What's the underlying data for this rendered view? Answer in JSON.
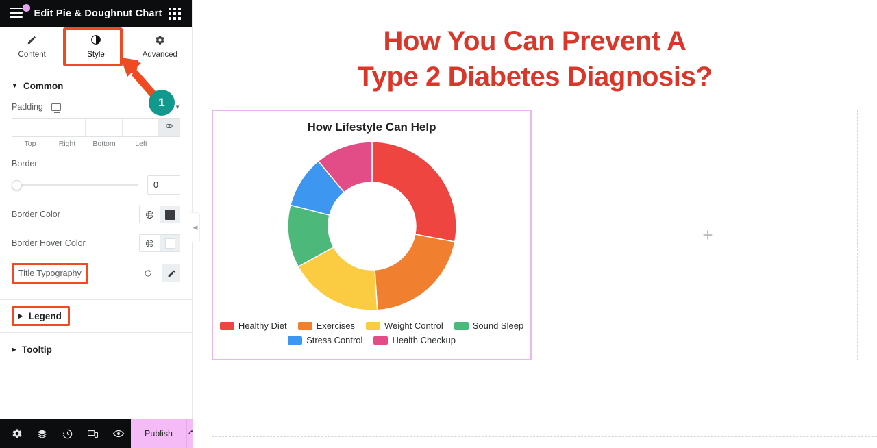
{
  "panel": {
    "title": "Edit Pie & Doughnut Chart",
    "menu_icon": "hamburger-icon",
    "grid_icon": "app-grid-icon",
    "tabs": [
      {
        "label": "Content",
        "icon": "pencil-icon",
        "active": false
      },
      {
        "label": "Style",
        "icon": "contrast-icon",
        "active": true
      },
      {
        "label": "Advanced",
        "icon": "gear-icon",
        "active": false
      }
    ],
    "sections": [
      {
        "label": "Common",
        "expanded": true
      },
      {
        "label": "Legend",
        "expanded": false
      },
      {
        "label": "Tooltip",
        "expanded": false
      }
    ],
    "common": {
      "padding": {
        "label": "Padding",
        "device_icon": "desktop-icon",
        "unit": "px",
        "unit_caret": "chevron-down-icon",
        "link_icon": "link-icon",
        "values": {
          "top": "",
          "right": "",
          "bottom": "",
          "left": ""
        },
        "placeholders": {
          "top": "",
          "right": "",
          "bottom": "",
          "left": ""
        },
        "captions": [
          "Top",
          "Right",
          "Bottom",
          "Left"
        ]
      },
      "border": {
        "label": "Border",
        "value": "0",
        "slider_percent": 0
      },
      "border_color": {
        "label": "Border Color",
        "globe_icon": "globe-icon",
        "swatch_hex": "#3b3b3f"
      },
      "border_hover_color": {
        "label": "Border Hover Color",
        "globe_icon": "globe-icon",
        "swatch_hex": "#ffffff"
      },
      "title_typography": {
        "label": "Title Typography",
        "reset_icon": "reset-icon",
        "edit_icon": "pencil-edit-icon",
        "highlighted": true
      }
    },
    "collapse_handle_icon": "chevron-left-icon",
    "footer": {
      "icons": [
        "gear-icon",
        "layers-icon",
        "history-icon",
        "responsive-icon",
        "eye-preview-icon"
      ],
      "publish_label": "Publish",
      "publish_caret_icon": "chevron-up-icon",
      "publish_color": "#f4bbf7"
    }
  },
  "annotation": {
    "step_number": "1",
    "badge_color": "#11998e",
    "arrow_color": "#f04a22",
    "highlight_color": "#f04a22"
  },
  "canvas": {
    "heading_line1": "How You Can Prevent A",
    "heading_line2": "Type 2 Diabetes Diagnosis?",
    "heading_color": "#d9372a",
    "empty_column": {
      "add_icon": "plus-icon"
    },
    "selection_border_color": "#e9b6ef"
  },
  "chart_data": {
    "type": "pie",
    "variant": "doughnut",
    "title": "How Lifestyle Can Help",
    "categories": [
      "Healthy Diet",
      "Exercises",
      "Weight Control",
      "Sound Sleep",
      "Stress Control",
      "Health Checkup"
    ],
    "values": [
      28,
      21,
      18,
      12,
      10,
      11
    ],
    "colors": [
      "#ee4540",
      "#f08030",
      "#fbcb41",
      "#4cb97a",
      "#3d96f0",
      "#e34d87"
    ],
    "legend_position": "bottom",
    "legend_rows": [
      [
        "Healthy Diet",
        "Exercises",
        "Weight Control",
        "Sound Sleep"
      ],
      [
        "Stress Control",
        "Health Checkup"
      ]
    ],
    "inner_radius_ratio": 0.52,
    "start_angle": 0,
    "grid": false,
    "xlabel": "",
    "ylabel": ""
  }
}
